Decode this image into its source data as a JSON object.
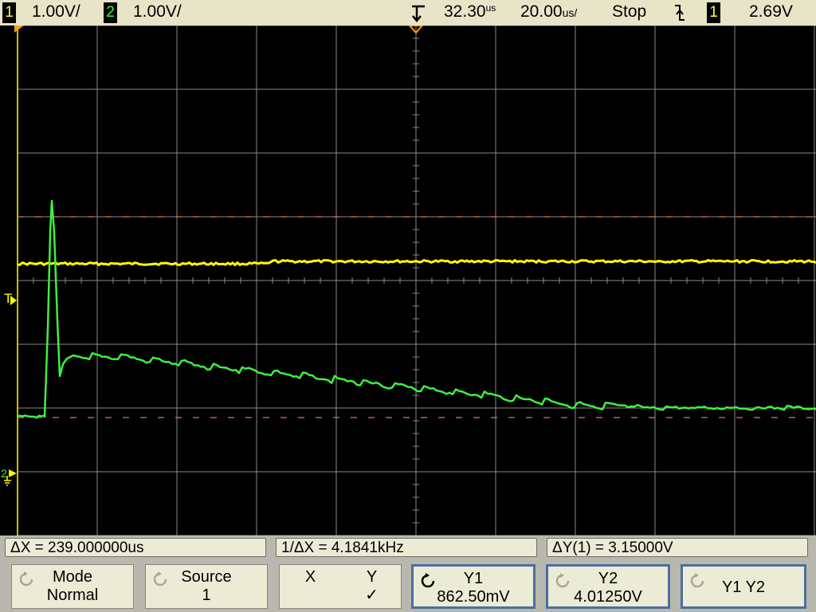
{
  "status_bar": {
    "ch1_number": "1",
    "ch1_scale": "1.00V/",
    "ch2_number": "2",
    "ch2_scale": "1.00V/",
    "time_delay": "32.30",
    "time_delay_unit": "us",
    "time_scale": "20.00",
    "time_scale_unit": "us/",
    "run_state": "Stop",
    "trigger_slope_icon": "falling-edge-icon",
    "trigger_source": "1",
    "trigger_level": "2.69V"
  },
  "screen": {
    "trigger_marker": "T",
    "ground_marker": "2",
    "colors": {
      "background": "#000000",
      "grid": "#8a8a8a",
      "channel1": "#ffff00",
      "channel2": "#3ff03f",
      "cursor": "#e07a4a",
      "marker": "#ff9a1a"
    }
  },
  "measurements": {
    "delta_x": "ΔX = 239.000000us",
    "inverse_delta_x": "1/ΔX = 4.1841kHz",
    "delta_y": "ΔY(1) = 3.15000V"
  },
  "softkeys": [
    {
      "line1": "Mode",
      "line2": "Normal",
      "icon": "rotary-knob-icon",
      "selected": false
    },
    {
      "line1": "Source",
      "line2": "1",
      "icon": "rotary-knob-icon",
      "selected": false
    },
    {
      "line1": "X",
      "line1b": "Y",
      "line2": "✓",
      "selected": false
    },
    {
      "line1": "Y1",
      "line2": "862.50mV",
      "icon": "rotary-knob-icon",
      "selected": true
    },
    {
      "line1": "Y2",
      "line2": "4.01250V",
      "icon": "rotary-knob-icon",
      "selected": true
    },
    {
      "line1": "Y1 Y2",
      "line2": "",
      "icon": "rotary-knob-icon",
      "selected": true
    }
  ]
}
